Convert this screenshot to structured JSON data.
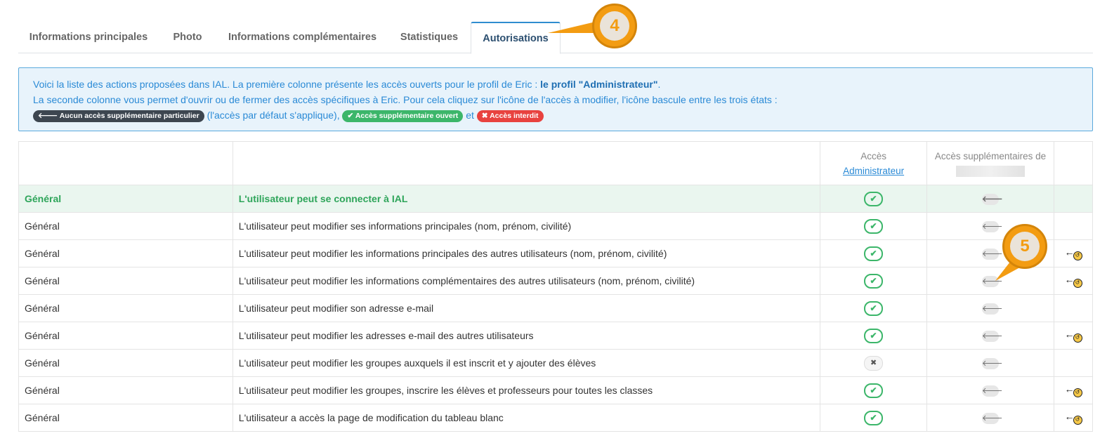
{
  "tabs": [
    {
      "label": "Informations principales"
    },
    {
      "label": "Photo"
    },
    {
      "label": "Informations complémentaires"
    },
    {
      "label": "Statistiques"
    },
    {
      "label": "Autorisations"
    }
  ],
  "callouts": {
    "tabs": "4",
    "rows": "5"
  },
  "info": {
    "line1_text": "Voici la liste des actions proposées dans IAL. La première colonne présente les accès ouverts pour le profil de Eric : ",
    "line1_bold": "le profil \"Administrateur\"",
    "line1_end": ".",
    "line2": "La seconde colonne vous permet d'ouvrir ou de fermer des accès spécifiques à Eric. Pour cela cliquez sur l'icône de l'accès à modifier, l'icône bascule entre les trois états :",
    "pill_default": "Aucun accès supplémentaire particulier",
    "text_default": "(l'accès par défaut s'applique),",
    "pill_open": "Accès supplémentaire ouvert",
    "text_and": "et",
    "pill_forbidden": "Accès interdit"
  },
  "table": {
    "header_access": "Accès",
    "header_access_link": "Administrateur",
    "header_extra": "Accès supplémentaires de",
    "rows": [
      {
        "category": "Général",
        "label": "L'utilisateur peut se connecter à IAL",
        "access": "ok",
        "history": false
      },
      {
        "category": "Général",
        "label": "L'utilisateur peut modifier ses informations principales (nom, prénom, civilité)",
        "access": "ok",
        "history": false
      },
      {
        "category": "Général",
        "label": "L'utilisateur peut modifier les informations principales des autres utilisateurs (nom, prénom, civilité)",
        "access": "ok",
        "history": true
      },
      {
        "category": "Général",
        "label": "L'utilisateur peut modifier les informations complémentaires des autres utilisateurs (nom, prénom, civilité)",
        "access": "ok",
        "history": true
      },
      {
        "category": "Général",
        "label": "L'utilisateur peut modifier son adresse e-mail",
        "access": "ok",
        "history": false
      },
      {
        "category": "Général",
        "label": "L'utilisateur peut modifier les adresses e-mail des autres utilisateurs",
        "access": "ok",
        "history": true
      },
      {
        "category": "Général",
        "label": "L'utilisateur peut modifier les groupes auxquels il est inscrit et y ajouter des élèves",
        "access": "no",
        "history": false
      },
      {
        "category": "Général",
        "label": "L'utilisateur peut modifier les groupes, inscrire les élèves et professeurs pour toutes les classes",
        "access": "ok",
        "history": true
      },
      {
        "category": "Général",
        "label": "L'utilisateur a accès la page de modification du tableau blanc",
        "access": "ok",
        "history": true
      }
    ]
  },
  "colors": {
    "accent": "#2e8ccf",
    "callout": "#f39c12",
    "ok": "#3cb66a",
    "forbidden": "#e8423f"
  }
}
